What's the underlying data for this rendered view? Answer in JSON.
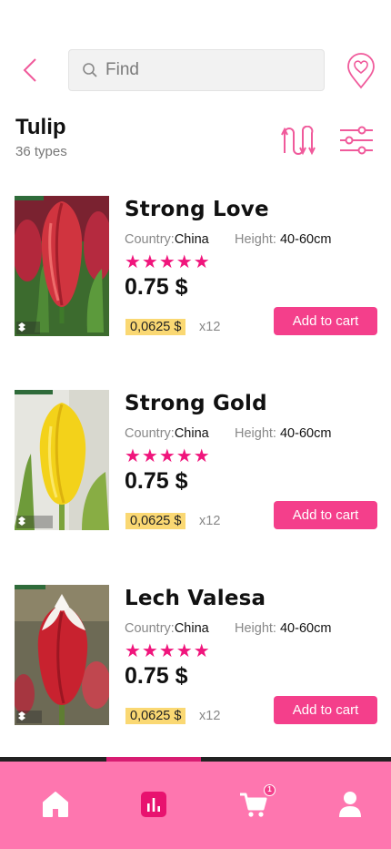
{
  "search": {
    "placeholder": "Find"
  },
  "header": {
    "title": "Tulip",
    "subtitle": "36 types"
  },
  "labels": {
    "country": "Country:",
    "height": "Height:"
  },
  "products": [
    {
      "name": "Strong Love",
      "country": "China",
      "height": "40-60cm",
      "stars": "★★★★★",
      "price": "0.75 $",
      "unit_price": "0,0625 $",
      "quantity": "x12",
      "button": "Add to cart",
      "image": "red-tulip"
    },
    {
      "name": "Strong Gold",
      "country": "China",
      "height": "40-60cm",
      "stars": "★★★★★",
      "price": "0.75 $",
      "unit_price": "0,0625 $",
      "quantity": "x12",
      "button": "Add to cart",
      "image": "yellow-tulip"
    },
    {
      "name": "Lech Valesa",
      "country": "China",
      "height": "40-60cm",
      "stars": "★★★★★",
      "price": "0.75 $",
      "unit_price": "0,0625 $",
      "quantity": "x12",
      "button": "Add to cart",
      "image": "red-white-tulip"
    }
  ],
  "nav": {
    "cart_badge": "1",
    "items": [
      "home-icon",
      "stats-icon",
      "cart-icon",
      "profile-icon"
    ]
  },
  "colors": {
    "accent": "#f43f8b",
    "nav_bg": "#fe76af",
    "star": "#f0157c",
    "unit_tag": "#fad873"
  }
}
